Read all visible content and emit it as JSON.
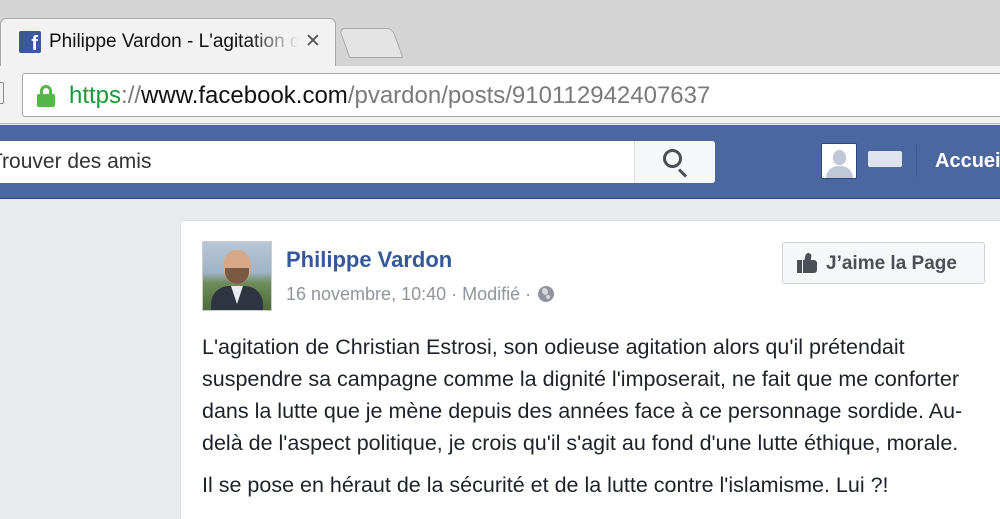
{
  "browser": {
    "tab": {
      "favicon": "facebook-icon",
      "title": "Philippe Vardon - L'agitation de Christian Estrosi",
      "close_label": "✕"
    },
    "address_bar": {
      "scheme": "https",
      "separator": "://",
      "host": "www.facebook.com",
      "path": "/pvardon/posts/910112942407637"
    }
  },
  "facebook": {
    "search": {
      "placeholder": "Trouver des amis"
    },
    "nav": {
      "home_label": "Accueil"
    },
    "colors": {
      "blue_bar": "#4c679f",
      "link": "#365899"
    }
  },
  "post": {
    "author": "Philippe Vardon",
    "meta": "16 novembre, 10:40 · Modifié · ",
    "privacy_icon": "globe-icon",
    "like_page_label": "J’aime la Page",
    "paragraphs": [
      "L'agitation de Christian Estrosi, son odieuse agitation alors qu'il prétendait suspendre sa campagne comme la dignité l'imposerait, ne fait que me conforter dans la lutte que je mène depuis des années face à ce personnage sordide. Au-delà de l'aspect politique, je crois qu'il s'agit au fond d'une lutte éthique, morale.",
      "Il se pose en héraut de la sécurité et de la lutte contre l'islamisme. Lui ?!"
    ]
  }
}
